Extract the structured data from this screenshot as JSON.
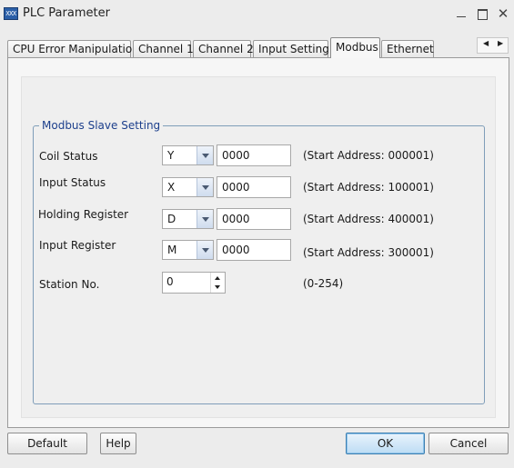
{
  "window": {
    "title": "PLC Parameter",
    "icon": "plc-app-icon",
    "icon_text": "XXX",
    "minimize": "minimize-icon",
    "maximize": "maximize-icon",
    "close": "close-icon",
    "close_glyph": "✕"
  },
  "tabs": [
    {
      "label": "CPU Error Manipulation",
      "active": false
    },
    {
      "label": "Channel 1",
      "active": false
    },
    {
      "label": "Channel 2",
      "active": false
    },
    {
      "label": "Input Setting",
      "active": false
    },
    {
      "label": "Modbus",
      "active": true
    },
    {
      "label": "Ethernet",
      "active": false
    }
  ],
  "tab_scroll": {
    "left": "◀",
    "right": "▶"
  },
  "modbus": {
    "group_title": "Modbus Slave Setting",
    "rows": [
      {
        "label": "Coil Status",
        "device": "Y",
        "address": "0000",
        "range_text": "(Start Address: 000001)"
      },
      {
        "label": "Input Status",
        "device": "X",
        "address": "0000",
        "range_text": "(Start Address: 100001)"
      },
      {
        "label": "Holding Register",
        "device": "D",
        "address": "0000",
        "range_text": "(Start Address: 400001)"
      },
      {
        "label": "Input Register",
        "device": "M",
        "address": "0000",
        "range_text": "(Start Address: 300001)"
      }
    ],
    "station": {
      "label": "Station No.",
      "value": "0",
      "range_text": "(0-254)"
    }
  },
  "buttons": {
    "default": "Default",
    "help": "Help",
    "ok": "OK",
    "cancel": "Cancel"
  },
  "colors": {
    "group_title": "#1c3f8c",
    "ok_accent": "#3c7fb1"
  }
}
